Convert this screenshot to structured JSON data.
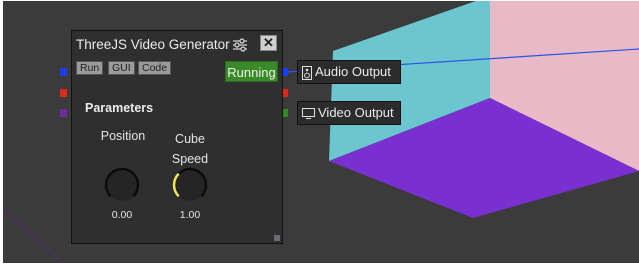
{
  "node": {
    "title": "ThreeJS Video Generator",
    "close_label": "✕",
    "buttons": {
      "run": "Run",
      "gui": "GUI",
      "code": "Code"
    },
    "status": "Running",
    "parameters_title": "Parameters",
    "params": [
      {
        "label": "Position",
        "value": "0.00"
      },
      {
        "label": "Cube\nSpeed",
        "value": "1.00"
      }
    ]
  },
  "outputs": {
    "audio": "Audio Output",
    "video": "Video Output"
  },
  "colors": {
    "canvas": "#3b3b3b",
    "cube_top": "#7a2fd0",
    "cube_left": "#6cc6cf",
    "cube_right": "#e8b9c6",
    "port_audio": "#1b3cf0",
    "port_control": "#e0271b",
    "port_purple": "#6a2aa0",
    "port_video": "#2f8a1f",
    "running": "#3b8a2a"
  },
  "icons": [
    "sliders-icon",
    "close-icon",
    "speaker-icon",
    "monitor-icon"
  ]
}
